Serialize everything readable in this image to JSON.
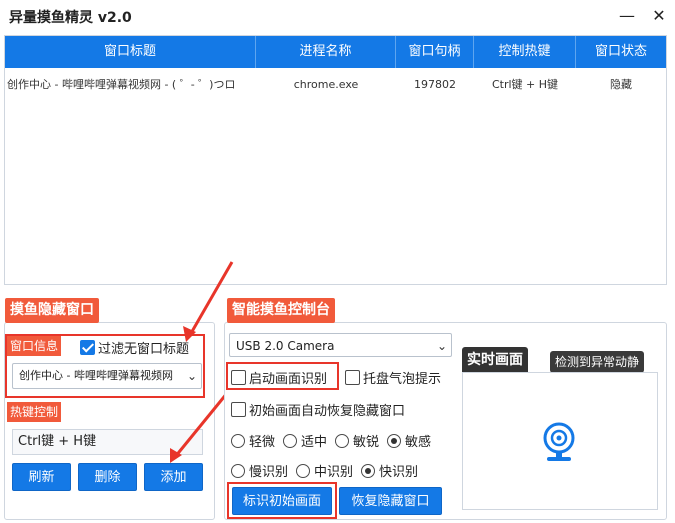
{
  "window": {
    "title": "异量摸鱼精灵 v2.0",
    "minimize_glyph": "—",
    "close_glyph": "✕"
  },
  "table": {
    "columns": [
      "窗口标题",
      "进程名称",
      "窗口句柄",
      "控制热键",
      "窗口状态"
    ],
    "rows": [
      {
        "title": "创作中心 - 哔哩哔哩弹幕视频网 - ( ゜- ゜)つロ",
        "process": "chrome.exe",
        "handle": "197802",
        "hotkey": "Ctrl键 + H键",
        "status": "隐藏"
      }
    ]
  },
  "hide_panel": {
    "header": "摸鱼隐藏窗口",
    "window_info_label": "窗口信息",
    "filter_checkbox_label": "过滤无窗口标题",
    "filter_checked": true,
    "window_select_value": "创作中心 - 哔哩哔哩弹幕视频网",
    "hotkey_label": "热键控制",
    "hotkey_value": "Ctrl键 + H键",
    "buttons": {
      "refresh": "刷新",
      "delete": "删除",
      "add": "添加"
    }
  },
  "control_panel": {
    "header": "智能摸鱼控制台",
    "camera_select_value": "USB 2.0 Camera",
    "start_recognition_label": "启动画面识别",
    "start_recognition_checked": false,
    "tray_bubble_label": "托盘气泡提示",
    "tray_bubble_checked": false,
    "auto_restore_label": "初始画面自动恢复隐藏窗口",
    "auto_restore_checked": false,
    "sensitivity_options": [
      "轻微",
      "适中",
      "敏锐",
      "敏感"
    ],
    "sensitivity_selected": 3,
    "speed_options": [
      "慢识别",
      "中识别",
      "快识别"
    ],
    "speed_selected": 2,
    "mark_initial_button": "标识初始画面",
    "restore_hidden_button": "恢复隐藏窗口"
  },
  "preview": {
    "realtime_label": "实时画面",
    "motion_label": "检测到异常动静",
    "icon": "webcam-icon"
  },
  "colors": {
    "accent_blue": "#1479e6",
    "tag_red": "#f15a3b",
    "highlight_red": "#e8352a"
  }
}
